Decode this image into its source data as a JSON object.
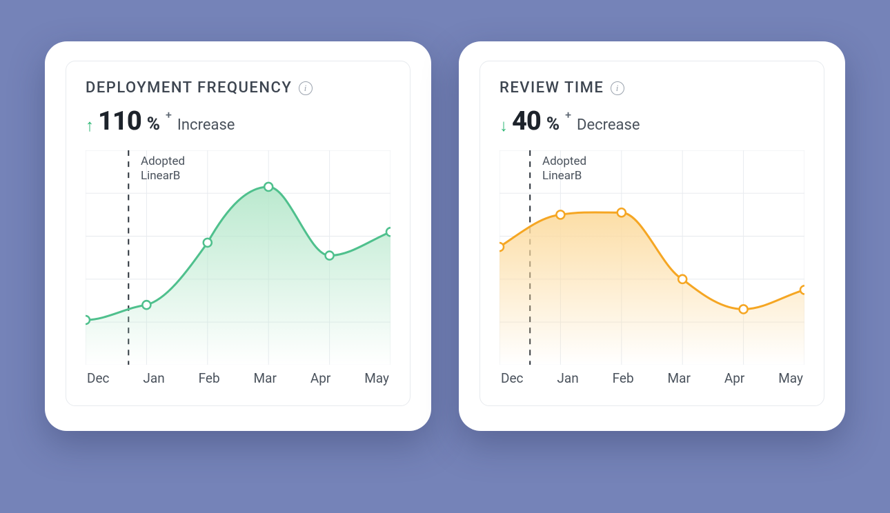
{
  "cards": [
    {
      "title": "DEPLOYMENT FREQUENCY",
      "arrow": "↑",
      "value": "110",
      "pct": "%",
      "sup": "+",
      "label": "Increase",
      "annotation_l1": "Adopted",
      "annotation_l2": "LinearB",
      "color": "#2bb673"
    },
    {
      "title": "REVIEW TIME",
      "arrow": "↓",
      "value": "40",
      "pct": "%",
      "sup": "+",
      "label": "Decrease",
      "annotation_l1": "Adopted",
      "annotation_l2": "LinearB",
      "color": "#f5a623"
    }
  ],
  "x_ticks": [
    "Dec",
    "Jan",
    "Feb",
    "Mar",
    "Apr",
    "May"
  ],
  "chart_data": [
    {
      "type": "area",
      "title": "Deployment Frequency",
      "x": [
        "Dec",
        "Jan",
        "Feb",
        "Mar",
        "Apr",
        "May"
      ],
      "values": [
        21,
        28,
        57,
        83,
        51,
        62
      ],
      "ylim": [
        0,
        100
      ],
      "annotation": "Adopted LinearB",
      "annotation_x": 0.7,
      "series_color": "#2bb673"
    },
    {
      "type": "area",
      "title": "Review Time",
      "x": [
        "Dec",
        "Jan",
        "Feb",
        "Mar",
        "Apr",
        "May"
      ],
      "values": [
        55,
        70,
        71,
        40,
        26,
        35
      ],
      "ylim": [
        0,
        100
      ],
      "annotation": "Adopted LinearB",
      "annotation_x": 0.5,
      "series_color": "#f5a623"
    }
  ]
}
